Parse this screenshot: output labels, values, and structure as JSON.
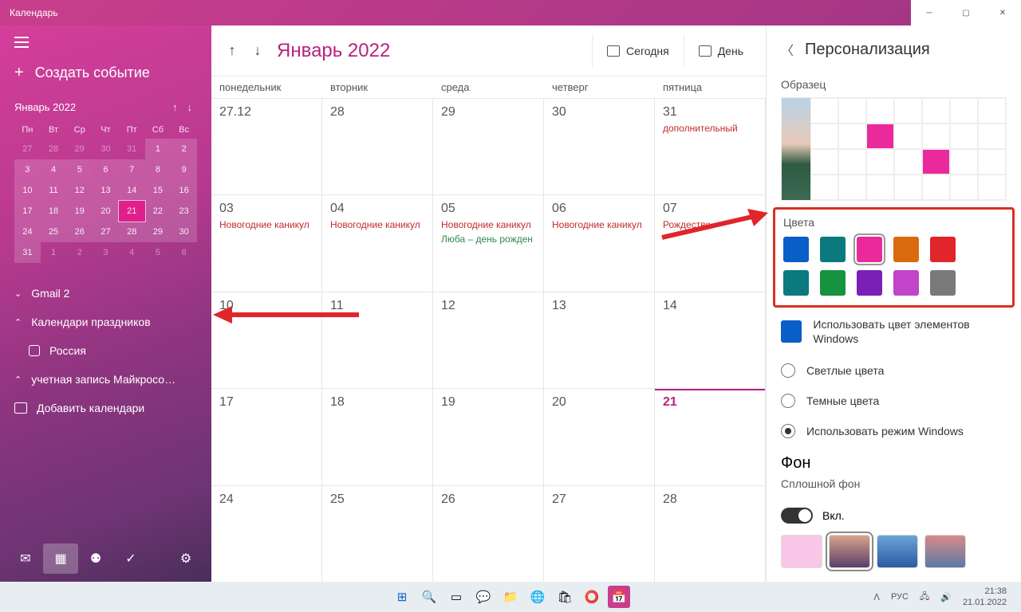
{
  "titlebar": {
    "title": "Календарь"
  },
  "sidebar": {
    "new_event": "Создать событие",
    "mini_month": "Январь 2022",
    "weekdays": [
      "Пн",
      "Вт",
      "Ср",
      "Чт",
      "Пт",
      "Сб",
      "Вс"
    ],
    "gmail": "Gmail 2",
    "holidays": "Календари праздников",
    "russia": "Россия",
    "ms_account": "учетная запись Майкросо…",
    "add_cal": "Добавить календари"
  },
  "toolbar": {
    "month": "Январь 2022",
    "today": "Сегодня",
    "day": "День"
  },
  "headers": [
    "понедельник",
    "вторник",
    "среда",
    "четверг",
    "пятница"
  ],
  "weeks": [
    [
      {
        "n": "27.12"
      },
      {
        "n": "28"
      },
      {
        "n": "29"
      },
      {
        "n": "30"
      },
      {
        "n": "31",
        "ev": "дополнительный"
      }
    ],
    [
      {
        "n": "03",
        "ev": "Новогодние каникул"
      },
      {
        "n": "04",
        "ev": "Новогодние каникул"
      },
      {
        "n": "05",
        "ev": "Новогодние каникул",
        "ev2": "Люба – день рожден"
      },
      {
        "n": "06",
        "ev": "Новогодние каникул"
      },
      {
        "n": "07",
        "ev": "Рождество"
      }
    ],
    [
      {
        "n": "10"
      },
      {
        "n": "11"
      },
      {
        "n": "12"
      },
      {
        "n": "13"
      },
      {
        "n": "14"
      }
    ],
    [
      {
        "n": "17"
      },
      {
        "n": "18"
      },
      {
        "n": "19"
      },
      {
        "n": "20"
      },
      {
        "n": "21",
        "today": true
      }
    ],
    [
      {
        "n": "24"
      },
      {
        "n": "25"
      },
      {
        "n": "26"
      },
      {
        "n": "27"
      },
      {
        "n": "28"
      }
    ]
  ],
  "panel": {
    "title": "Персонализация",
    "sample": "Образец",
    "colors": "Цвета",
    "use_windows": "Использовать цвет элементов Windows",
    "light": "Светлые цвета",
    "dark": "Темные цвета",
    "win_mode": "Использовать режим Windows",
    "bg": "Фон",
    "solid_bg": "Сплошной фон",
    "on": "Вкл.",
    "swatches1": [
      "#0a5ec7",
      "#0a7a7e",
      "#ea2a9a",
      "#d96a0d",
      "#e0252b"
    ],
    "swatches2": [
      "#0a7a7e",
      "#15933e",
      "#7a20b7",
      "#c144c9",
      "#7a7a7a"
    ]
  },
  "taskbar": {
    "lang": "РУС",
    "time": "21:38",
    "date": "21.01.2022"
  },
  "mini_days": [
    {
      "d": "27",
      "dim": true
    },
    {
      "d": "28",
      "dim": true
    },
    {
      "d": "29",
      "dim": true
    },
    {
      "d": "30",
      "dim": true
    },
    {
      "d": "31",
      "dim": true
    },
    {
      "d": "1",
      "hl": true
    },
    {
      "d": "2",
      "hl": true
    },
    {
      "d": "3",
      "hl": true
    },
    {
      "d": "4",
      "hl": true
    },
    {
      "d": "5",
      "hl": true
    },
    {
      "d": "6",
      "hl": true
    },
    {
      "d": "7",
      "hl": true
    },
    {
      "d": "8",
      "hl": true
    },
    {
      "d": "9",
      "hl": true
    },
    {
      "d": "10",
      "hl": true
    },
    {
      "d": "11",
      "hl": true
    },
    {
      "d": "12",
      "hl": true
    },
    {
      "d": "13",
      "hl": true
    },
    {
      "d": "14",
      "hl": true
    },
    {
      "d": "15",
      "hl": true
    },
    {
      "d": "16",
      "hl": true
    },
    {
      "d": "17",
      "hl": true
    },
    {
      "d": "18",
      "hl": true
    },
    {
      "d": "19",
      "hl": true
    },
    {
      "d": "20",
      "hl": true
    },
    {
      "d": "21",
      "today": true
    },
    {
      "d": "22",
      "hl": true
    },
    {
      "d": "23",
      "hl": true
    },
    {
      "d": "24",
      "hl": true
    },
    {
      "d": "25",
      "hl": true
    },
    {
      "d": "26",
      "hl": true
    },
    {
      "d": "27",
      "hl": true
    },
    {
      "d": "28",
      "hl": true
    },
    {
      "d": "29",
      "hl": true
    },
    {
      "d": "30",
      "hl": true
    },
    {
      "d": "31",
      "hl": true
    },
    {
      "d": "1",
      "dim": true
    },
    {
      "d": "2",
      "dim": true
    },
    {
      "d": "3",
      "dim": true
    },
    {
      "d": "4",
      "dim": true
    },
    {
      "d": "5",
      "dim": true
    },
    {
      "d": "6",
      "dim": true
    }
  ]
}
